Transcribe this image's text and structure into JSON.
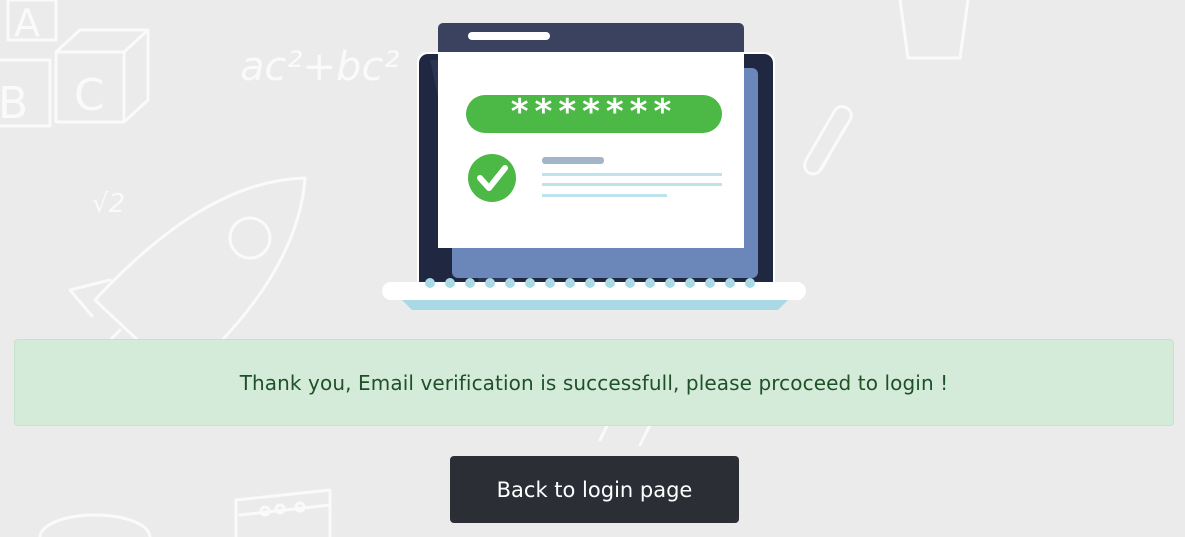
{
  "background": {
    "doodles": [
      "abc-blocks-icon",
      "formula-doodle-icon",
      "sqrt-doodle-icon",
      "rocket-icon",
      "paperclip-icon",
      "cup-icon",
      "abacus-icon"
    ],
    "formula_text": "ac²+bc²",
    "sqrt_text": "√2",
    "blocks": [
      "A",
      "B",
      "C"
    ]
  },
  "illustration": {
    "password_mask": "*******",
    "check_color": "#4cb846",
    "pill_color": "#4cb846"
  },
  "alert": {
    "message": "Thank you, Email verification is successfull, please prcoceed to login !",
    "background": "#d5ebda",
    "text_color": "#1e5128"
  },
  "actions": {
    "back_label": "Back to login page"
  }
}
